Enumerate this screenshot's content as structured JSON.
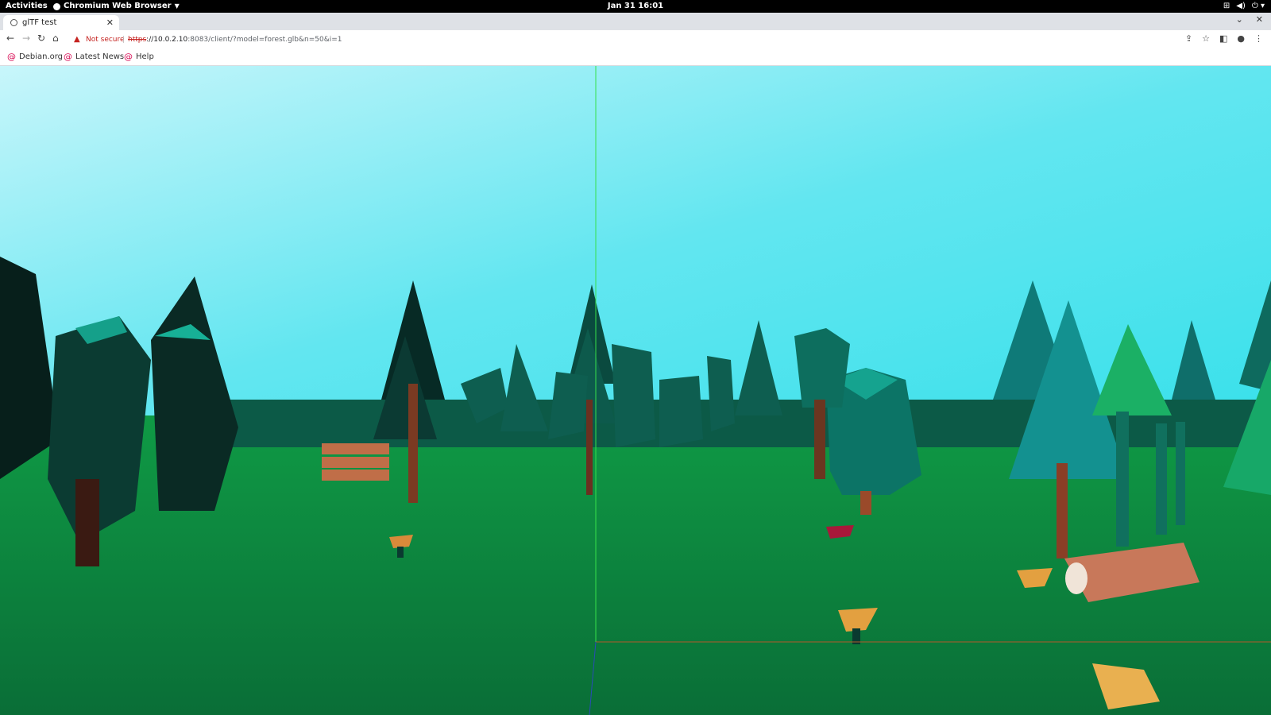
{
  "system_bar": {
    "activities": "Activities",
    "app_name": "Chromium Web Browser",
    "clock": "Jan 31  16:01"
  },
  "browser": {
    "tab_title": "glTF test",
    "omnibox": {
      "security_label": "Not secure",
      "url_scheme": "https",
      "url_host": "://10.0.2.10",
      "url_rest": ":8083/client/?model=forest.glb&n=50&i=1"
    },
    "bookmarks": [
      {
        "label": "Debian.org"
      },
      {
        "label": "Latest News"
      },
      {
        "label": "Help"
      }
    ]
  },
  "scene": {
    "sky_top": "#c8f6fb",
    "sky_bottom": "#37e0ea",
    "ground": "#0b7a3c",
    "axis_x_color": "#b05a2a",
    "axis_y_color": "#36e04a",
    "axis_z_color": "#2a4ab8"
  }
}
